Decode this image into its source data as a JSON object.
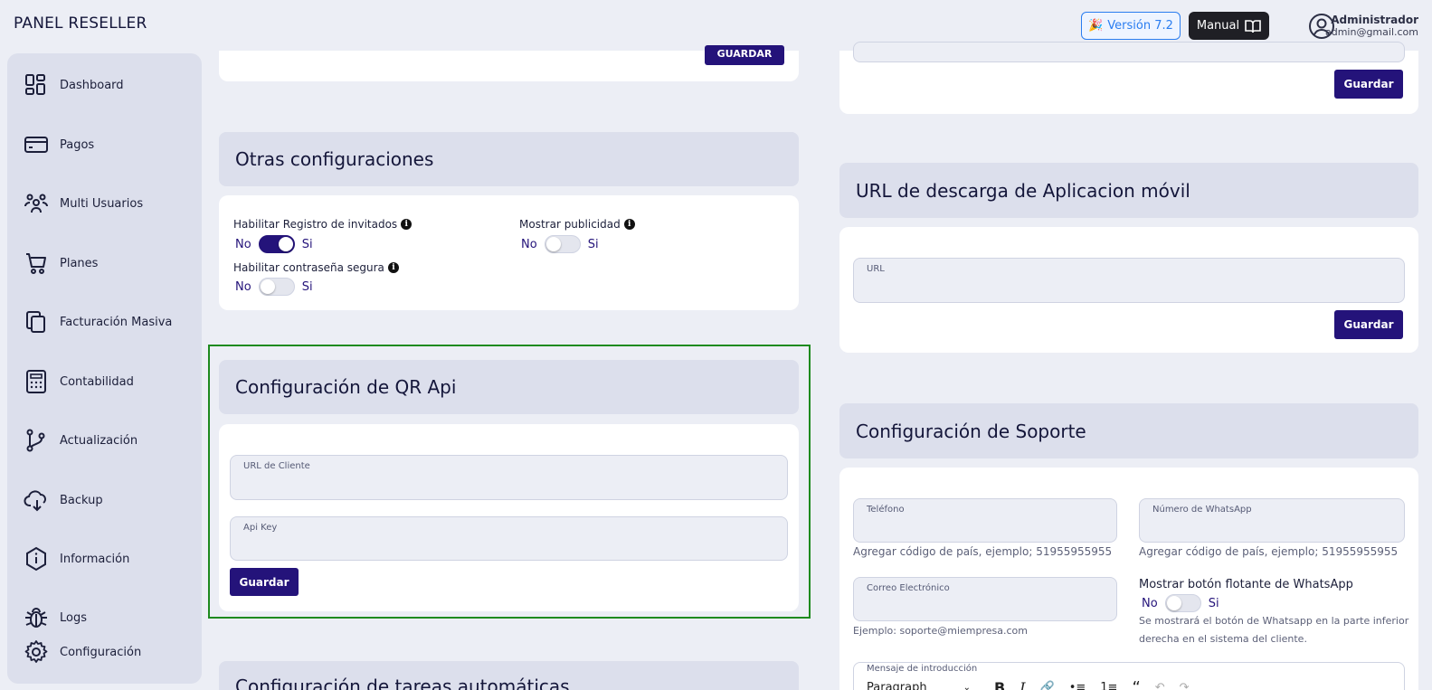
{
  "header": {
    "brand": "PANEL RESELLER",
    "version_label": "Versión 7.2",
    "manual_label": "Manual",
    "user_name": "Administrador",
    "user_email": "admin@gmail.com"
  },
  "sidebar": {
    "items": [
      {
        "label": "Dashboard",
        "icon": "dashboard-icon"
      },
      {
        "label": "Pagos",
        "icon": "credit-card-icon"
      },
      {
        "label": "Multi Usuarios",
        "icon": "users-icon"
      },
      {
        "label": "Planes",
        "icon": "cart-icon"
      },
      {
        "label": "Facturación Masiva",
        "icon": "copy-icon"
      },
      {
        "label": "Contabilidad",
        "icon": "calculator-icon"
      },
      {
        "label": "Actualización",
        "icon": "git-branch-icon"
      },
      {
        "label": "Backup",
        "icon": "cloud-download-icon"
      },
      {
        "label": "Información",
        "icon": "info-hexagon-icon"
      },
      {
        "label": "Logs",
        "icon": "bug-icon"
      },
      {
        "label": "Configuración",
        "icon": "gear-icon"
      }
    ]
  },
  "top_card": {
    "save_label": "GUARDAR"
  },
  "otras": {
    "title": "Otras configuraciones",
    "invitados_label": "Habilitar Registro de invitados",
    "publicidad_label": "Mostrar publicidad",
    "segura_label": "Habilitar contraseña segura",
    "no": "No",
    "si": "Si",
    "invitados_on": true,
    "publicidad_on": false,
    "segura_on": false
  },
  "qr": {
    "title": "Configuración de QR Api",
    "url_label": "URL de Cliente",
    "api_label": "Api Key",
    "save_label": "Guardar"
  },
  "tareas": {
    "title": "Configuración de tareas automáticas"
  },
  "right_top": {
    "save_label": "Guardar"
  },
  "app_url": {
    "title": "URL de descarga de Aplicacion móvil",
    "url_label": "URL",
    "save_label": "Guardar"
  },
  "soporte": {
    "title": "Configuración de Soporte",
    "telefono_label": "Teléfono",
    "telefono_hint": "Agregar código de país, ejemplo; 51955955955",
    "whatsapp_label": "Número de WhatsApp",
    "whatsapp_hint": "Agregar código de país, ejemplo; 51955955955",
    "correo_label": "Correo Electrónico",
    "correo_hint": "Ejemplo: soporte@miempresa.com",
    "flotante_label": "Mostrar botón flotante de WhatsApp",
    "flotante_on": false,
    "flotante_hint_1": "Se mostrará el botón de Whatsapp en la parte inferior",
    "flotante_hint_2": "derecha en el sistema del cliente.",
    "no": "No",
    "si": "Si",
    "mensaje_label": "Mensaje de introducción",
    "paragraph_label": "Paragraph"
  }
}
